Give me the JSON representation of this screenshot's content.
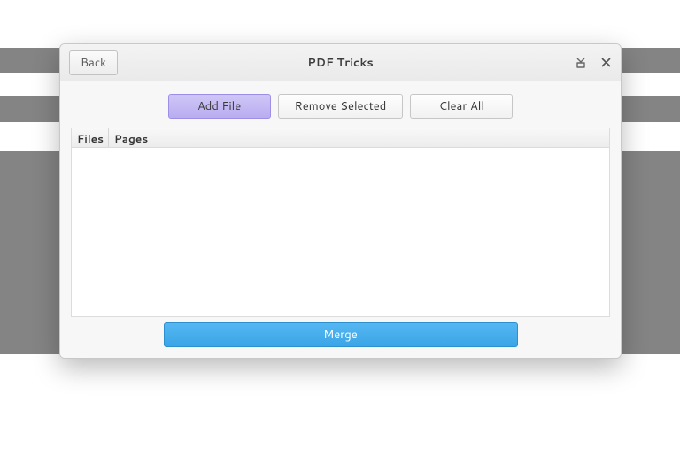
{
  "window": {
    "title": "PDF Tricks",
    "back_label": "Back"
  },
  "toolbar": {
    "add_file_label": "Add File",
    "remove_selected_label": "Remove Selected",
    "clear_all_label": "Clear All"
  },
  "table": {
    "columns": {
      "files": "Files",
      "pages": "Pages"
    },
    "rows": []
  },
  "actions": {
    "merge_label": "Merge"
  }
}
